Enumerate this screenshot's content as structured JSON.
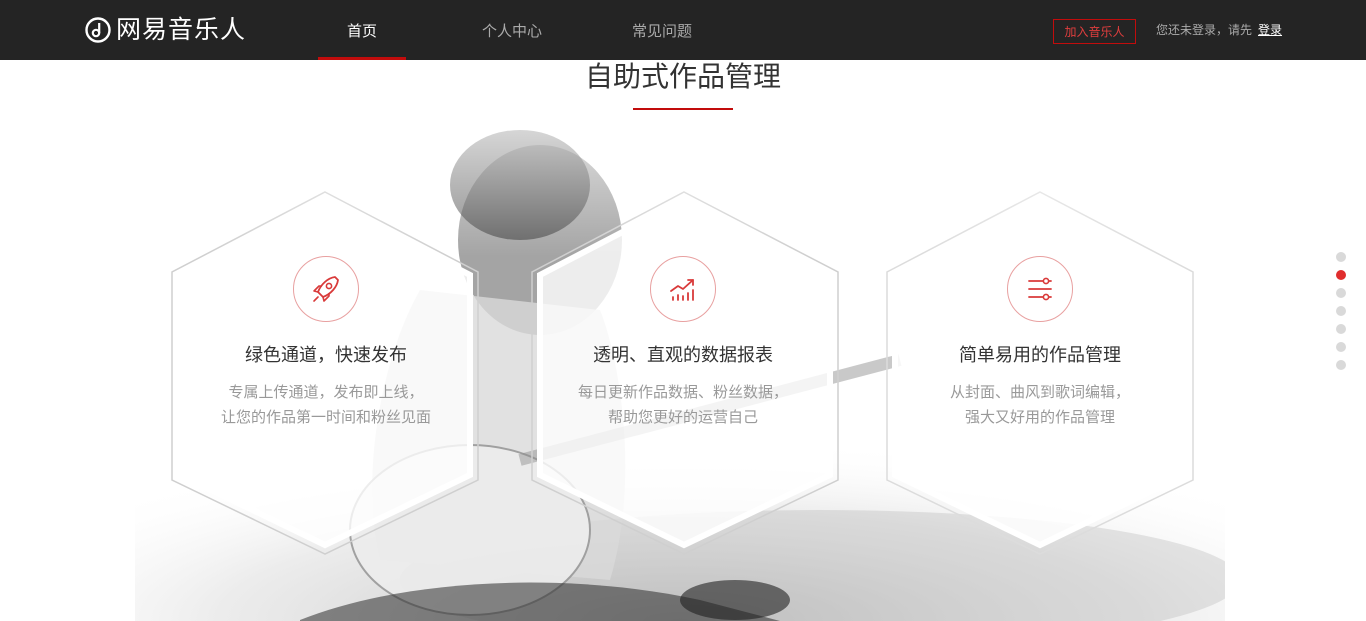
{
  "header": {
    "logo_text": "网易音乐人",
    "tabs": [
      {
        "label": "首页",
        "active": true
      },
      {
        "label": "个人中心",
        "active": false
      },
      {
        "label": "常见问题",
        "active": false
      }
    ],
    "join_button": "加入音乐人",
    "login_hint": "您还未登录，请先",
    "login_link": "登录"
  },
  "section": {
    "title": "自助式作品管理",
    "features": [
      {
        "icon": "rocket-icon",
        "title": "绿色通道，快速发布",
        "desc_line1": "专属上传通道，发布即上线，",
        "desc_line2": "让您的作品第一时间和粉丝见面"
      },
      {
        "icon": "chart-icon",
        "title": "透明、直观的数据报表",
        "desc_line1": "每日更新作品数据、粉丝数据，",
        "desc_line2": "帮助您更好的运营自己"
      },
      {
        "icon": "sliders-icon",
        "title": "简单易用的作品管理",
        "desc_line1": "从封面、曲风到歌词编辑，",
        "desc_line2": "强大又好用的作品管理"
      }
    ]
  },
  "pager": {
    "count": 7,
    "active_index": 1
  },
  "colors": {
    "topbar": "#242424",
    "accent": "#c20c0c",
    "dot_active": "#e02d2d",
    "dot_inactive": "#d9d9d9"
  }
}
